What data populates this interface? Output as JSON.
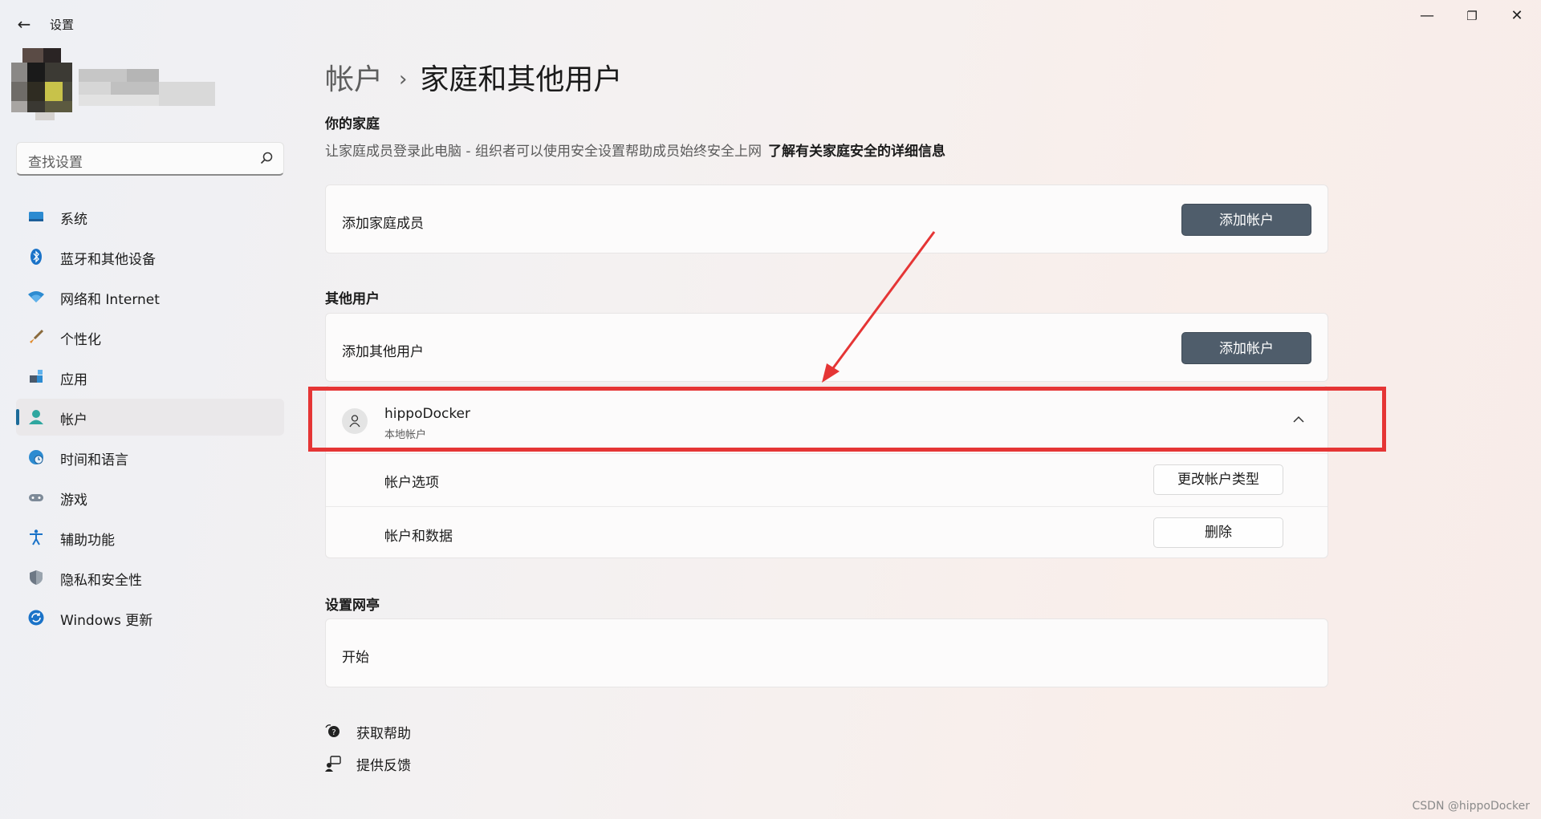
{
  "window": {
    "back_glyph": "←",
    "title": "设置",
    "minimize_glyph": "—",
    "maximize_glyph": "❐",
    "close_glyph": "✕"
  },
  "sidebar": {
    "search_placeholder": "查找设置",
    "items": [
      {
        "label": "系统",
        "icon": "monitor-icon"
      },
      {
        "label": "蓝牙和其他设备",
        "icon": "bluetooth-icon"
      },
      {
        "label": "网络和 Internet",
        "icon": "wifi-icon"
      },
      {
        "label": "个性化",
        "icon": "brush-icon"
      },
      {
        "label": "应用",
        "icon": "apps-icon"
      },
      {
        "label": "帐户",
        "icon": "person-icon",
        "active": true
      },
      {
        "label": "时间和语言",
        "icon": "clock-globe-icon"
      },
      {
        "label": "游戏",
        "icon": "gamepad-icon"
      },
      {
        "label": "辅助功能",
        "icon": "accessibility-icon"
      },
      {
        "label": "隐私和安全性",
        "icon": "shield-icon"
      },
      {
        "label": "Windows 更新",
        "icon": "update-icon"
      }
    ]
  },
  "main": {
    "breadcrumb_parent": "帐户",
    "breadcrumb_sep": "›",
    "breadcrumb_current": "家庭和其他用户",
    "family": {
      "title": "你的家庭",
      "desc": "让家庭成员登录此电脑 - 组织者可以使用安全设置帮助成员始终安全上网",
      "link": "了解有关家庭安全的详细信息",
      "add_label": "添加家庭成员",
      "add_button": "添加帐户"
    },
    "others": {
      "title": "其他用户",
      "add_label": "添加其他用户",
      "add_button": "添加帐户",
      "user": {
        "name": "hippoDocker",
        "type": "本地帐户",
        "options_label": "帐户选项",
        "options_button": "更改帐户类型",
        "data_label": "帐户和数据",
        "data_button": "删除"
      }
    },
    "kiosk": {
      "title": "设置网亭",
      "start_label": "开始"
    },
    "help": {
      "get_help": "获取帮助",
      "feedback": "提供反馈"
    }
  },
  "colors": {
    "accent_button": "#4f5d6b",
    "highlight": "#e53535",
    "active_indicator": "#1c6b99"
  },
  "watermark": "CSDN @hippoDocker"
}
